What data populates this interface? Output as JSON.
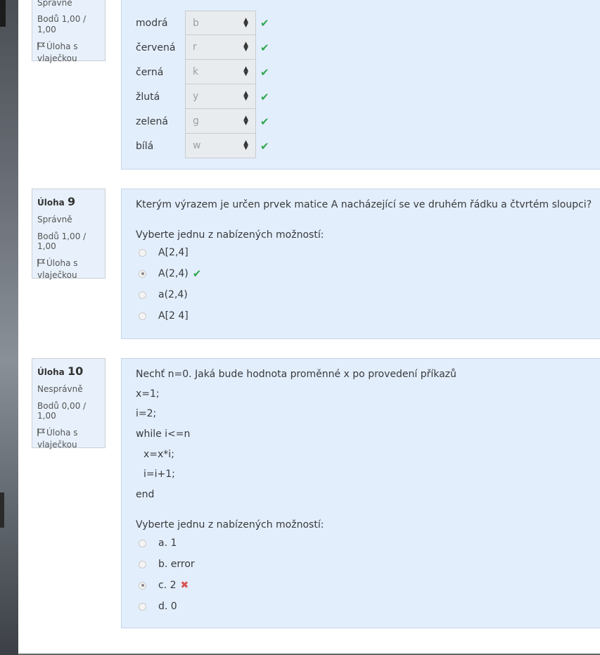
{
  "q8": {
    "status": "Správně",
    "score": "Bodů 1,00 / 1,00",
    "flag_line1": "Úloha s",
    "flag_line2": "vlaječkou",
    "rows": [
      {
        "label": "modrá",
        "value": "b"
      },
      {
        "label": "červená",
        "value": "r"
      },
      {
        "label": "černá",
        "value": "k"
      },
      {
        "label": "žlutá",
        "value": "y"
      },
      {
        "label": "zelená",
        "value": "g"
      },
      {
        "label": "bílá",
        "value": "w"
      }
    ]
  },
  "q9": {
    "prefix": "Úloha",
    "number": "9",
    "status": "Správně",
    "score": "Bodů 1,00 / 1,00",
    "flag_line1": "Úloha s",
    "flag_line2": "vlaječkou",
    "question": "Kterým výrazem je určen prvek matice A nacházející se ve druhém řádku a čtvrtém sloupci?",
    "prompt": "Vyberte jednu z nabízených možností:",
    "options": [
      "A[2,4]",
      "A(2,4)",
      "a(2,4)",
      "A[2 4]"
    ]
  },
  "q10": {
    "prefix": "Úloha",
    "number": "10",
    "status": "Nesprávně",
    "score": "Bodů 0,00 / 1,00",
    "flag_line1": "Úloha s",
    "flag_line2": "vlaječkou",
    "question": "Nechť n=0. Jaká bude hodnota proměnné x po provedení příkazů",
    "code": [
      "x=1;",
      "i=2;",
      "while i<=n",
      "x=x*i;",
      "i=i+1;",
      "end"
    ],
    "prompt": "Vyberte jednu z nabízených možností:",
    "options": [
      "a. 1",
      "b. error",
      "c. 2",
      "d. 0"
    ]
  },
  "icons": {
    "correct": "check-icon",
    "incorrect": "cross-icon",
    "flag": "flag-icon",
    "select_caret": "updown-caret-icon"
  },
  "colors": {
    "correct": "#2fa84f",
    "incorrect": "#d9534f",
    "panel": "#e3eefc"
  }
}
